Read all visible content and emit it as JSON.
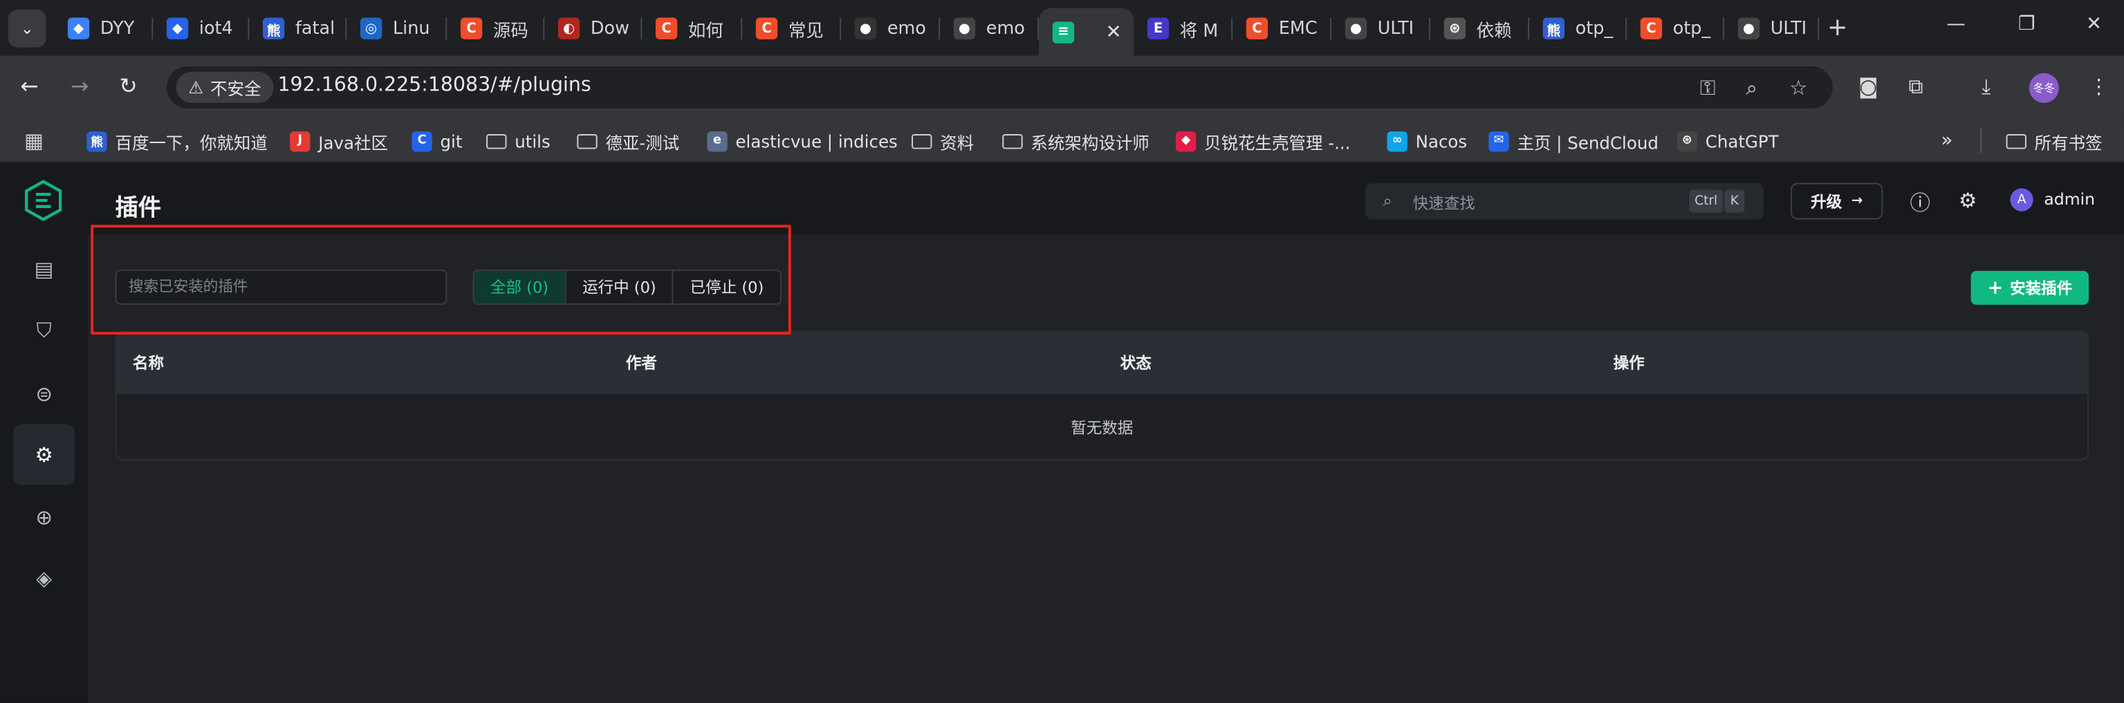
{
  "browser": {
    "tabs": [
      {
        "label": "DYY",
        "color": "#3b82f6",
        "glyph": "◆"
      },
      {
        "label": "iot4",
        "color": "#2563eb",
        "glyph": "◆"
      },
      {
        "label": "fatal",
        "color": "#2f5fd0",
        "glyph": "熊"
      },
      {
        "label": "Linu",
        "color": "#1e66c8",
        "glyph": "◎"
      },
      {
        "label": "源码",
        "color": "#f04e2b",
        "glyph": "C"
      },
      {
        "label": "Dow",
        "color": "#b3261e",
        "glyph": "◐"
      },
      {
        "label": "如何",
        "color": "#f04e2b",
        "glyph": "C"
      },
      {
        "label": "常见",
        "color": "#f04e2b",
        "glyph": "C"
      },
      {
        "label": "emo",
        "color": "#333333",
        "glyph": "●"
      },
      {
        "label": "emo",
        "color": "#444444",
        "glyph": "●"
      },
      {
        "label": "",
        "color": "#10b981",
        "glyph": "≡",
        "active": true
      },
      {
        "label": "将 M",
        "color": "#4338ca",
        "glyph": "E"
      },
      {
        "label": "EMC",
        "color": "#f04e2b",
        "glyph": "C"
      },
      {
        "label": "ULTI",
        "color": "#444444",
        "glyph": "●"
      },
      {
        "label": "依赖",
        "color": "#555555",
        "glyph": "⊛"
      },
      {
        "label": "otp_",
        "color": "#2f5fd0",
        "glyph": "熊"
      },
      {
        "label": "otp_",
        "color": "#f04e2b",
        "glyph": "C"
      },
      {
        "label": "ULTI",
        "color": "#444444",
        "glyph": "●"
      }
    ],
    "insecure_label": "不安全",
    "url": "192.168.0.225:18083/#/plugins",
    "profile_label": "冬冬",
    "bookmarks": [
      {
        "label": "百度一下，你就知道",
        "type": "fav",
        "color": "#2f5fd0",
        "glyph": "熊"
      },
      {
        "label": "Java社区",
        "type": "fav",
        "color": "#e53935",
        "glyph": "J"
      },
      {
        "label": "git",
        "type": "fav",
        "color": "#2563eb",
        "glyph": "C"
      },
      {
        "label": "utils",
        "type": "folder"
      },
      {
        "label": "德亚-测试",
        "type": "folder"
      },
      {
        "label": "elasticvue | indices",
        "type": "fav",
        "color": "#5b6b8c",
        "glyph": "e"
      },
      {
        "label": "资料",
        "type": "folder"
      },
      {
        "label": "系统架构设计师",
        "type": "folder"
      },
      {
        "label": "贝锐花生壳管理 -...",
        "type": "fav",
        "color": "#e11d48",
        "glyph": "◆"
      },
      {
        "label": "Nacos",
        "type": "fav",
        "color": "#0ea5e9",
        "glyph": "∞"
      },
      {
        "label": "主页 | SendCloud",
        "type": "fav",
        "color": "#2563eb",
        "glyph": "✉"
      },
      {
        "label": "ChatGPT",
        "type": "fav",
        "color": "#444444",
        "glyph": "⊛"
      }
    ],
    "all_bookmarks_label": "所有书签"
  },
  "app": {
    "page_title": "插件",
    "quick_search_placeholder": "快速查找",
    "kbd_ctrl": "Ctrl",
    "kbd_k": "K",
    "upgrade_label": "升级",
    "username": "admin",
    "avatar_letter": "A"
  },
  "plugins": {
    "search_placeholder": "搜索已安装的插件",
    "filters": [
      {
        "label": "全部 (0)",
        "active": true
      },
      {
        "label": "运行中 (0)",
        "active": false
      },
      {
        "label": "已停止 (0)",
        "active": false
      }
    ],
    "install_label": "安装插件",
    "columns": [
      "名称",
      "作者",
      "状态",
      "操作"
    ],
    "empty_text": "暂无数据"
  }
}
